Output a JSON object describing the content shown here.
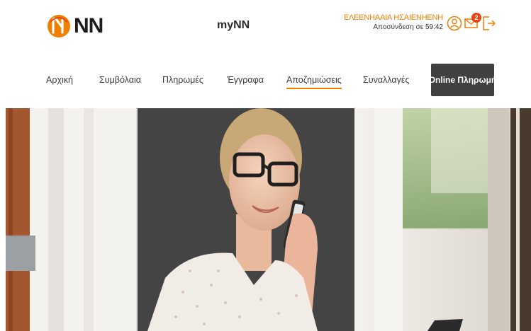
{
  "header": {
    "logo_text": "NN",
    "app_title": "myNN",
    "user_name": "ΕΛΕΕΝΗΑΑΙΑ ΗΣΑΙΕΝΗΕΝΗ",
    "session_text": "Αποσύνδεση σε 59:42",
    "notifications_count": "2",
    "brand_color": "#ee7f00"
  },
  "nav": {
    "items": [
      {
        "label": "Αρχική"
      },
      {
        "label": "Συμβόλαια"
      },
      {
        "label": "Πληρωμές"
      },
      {
        "label": "Έγγραφα"
      },
      {
        "label": "Αποζημιώσεις",
        "active": true
      },
      {
        "label": "Συναλλαγές"
      }
    ],
    "pay_button": "Online Πληρωμή"
  }
}
